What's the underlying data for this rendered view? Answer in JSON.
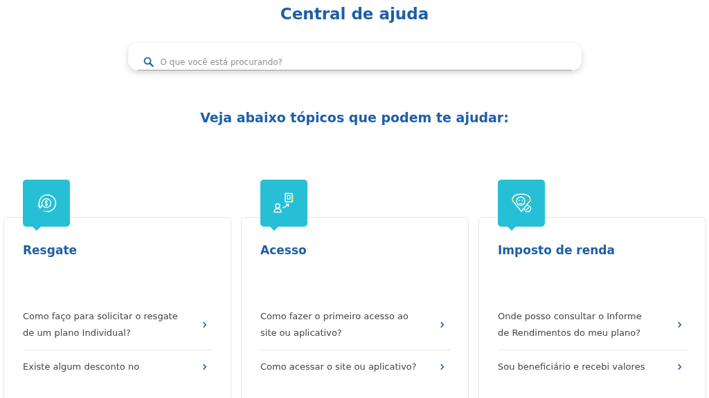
{
  "header": {
    "title": "Central de ajuda"
  },
  "search": {
    "placeholder": "O que você está procurando?"
  },
  "subtitle": "Veja abaixo tópicos que podem te ajudar:",
  "topics": [
    {
      "title": "Resgate",
      "questions": [
        "Como faço para solicitar o resgate de um plano Individual?",
        "Existe algum desconto no"
      ]
    },
    {
      "title": "Acesso",
      "questions": [
        "Como fazer o primeiro acesso ao site ou aplicativo?",
        "Como acessar o site ou aplicativo?"
      ]
    },
    {
      "title": "Imposto de renda",
      "questions": [
        "Onde posso consultar o Informe de Rendimentos do meu plano?",
        "Sou beneficiário e recebi valores"
      ]
    }
  ]
}
